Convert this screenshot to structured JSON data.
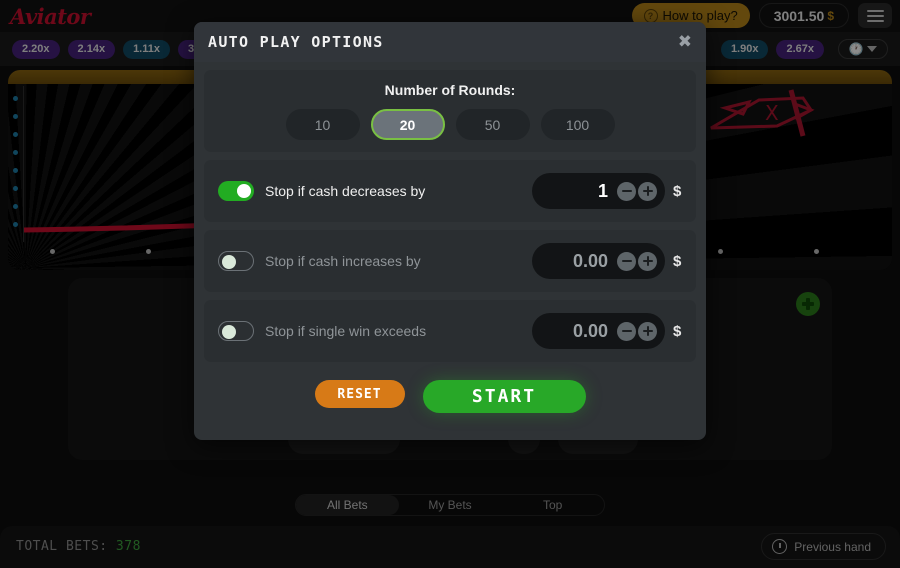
{
  "header": {
    "logo": "Aviator",
    "how_to_play": "How to play?",
    "how_to_play_icon": "question-circle-icon",
    "balance": "3001.50",
    "currency": "$",
    "menu_icon": "hamburger-menu-icon"
  },
  "multipliers": {
    "items": [
      {
        "value": "2.20x",
        "color": "purple"
      },
      {
        "value": "2.14x",
        "color": "purple"
      },
      {
        "value": "1.11x",
        "color": "blue"
      },
      {
        "value": "3",
        "color": "purple"
      },
      {
        "value": "1.90x",
        "color": "blue"
      },
      {
        "value": "2.67x",
        "color": "purple"
      }
    ],
    "history_icon": "history-clock-icon",
    "history_caret_icon": "caret-down-icon"
  },
  "game": {
    "plane_icon": "red-plane-icon",
    "add_bet_icon": "plus-circle-icon"
  },
  "modal": {
    "title": "AUTO PLAY OPTIONS",
    "close_icon": "close-x-icon",
    "rounds": {
      "label": "Number of Rounds:",
      "options": [
        "10",
        "20",
        "50",
        "100"
      ],
      "selected": "20"
    },
    "options": [
      {
        "label": "Stop if cash decreases by",
        "enabled": true,
        "value": "1",
        "currency": "$",
        "minus_icon": "minus-circle-icon",
        "plus_icon": "plus-circle-icon"
      },
      {
        "label": "Stop if cash increases by",
        "enabled": false,
        "value": "0.00",
        "currency": "$",
        "minus_icon": "minus-circle-icon",
        "plus_icon": "plus-circle-icon"
      },
      {
        "label": "Stop if single win exceeds",
        "enabled": false,
        "value": "0.00",
        "currency": "$",
        "minus_icon": "minus-circle-icon",
        "plus_icon": "plus-circle-icon"
      }
    ],
    "reset_label": "RESET",
    "start_label": "START"
  },
  "tabs": {
    "items": [
      "All Bets",
      "My Bets",
      "Top"
    ],
    "active": "All Bets"
  },
  "footer": {
    "total_bets_label": "TOTAL BETS:",
    "total_bets_count": "378",
    "previous_hand": "Previous hand",
    "previous_hand_icon": "history-clock-icon"
  },
  "colors": {
    "accent_green": "#28a828",
    "accent_orange": "#d77a17",
    "brand_red": "#c8102e",
    "gold": "#b58318"
  }
}
